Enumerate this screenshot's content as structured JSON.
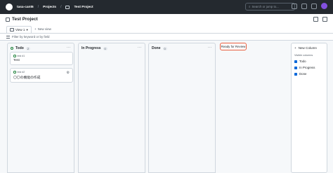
{
  "topbar": {
    "owner": "tasa-cant6",
    "projects": "Projects",
    "project": "Test Project",
    "search_placeholder": "Search or jump to..."
  },
  "header": {
    "title": "Test Project"
  },
  "views": {
    "active_tab": "View 1",
    "new_view": "New view",
    "filter_placeholder": "Filter by keyword or by field"
  },
  "columns": [
    {
      "name": "Todo",
      "count": "2",
      "color": "#1a7f37",
      "cards": [
        {
          "meta": "test #1",
          "title": "Test"
        },
        {
          "meta": "test #2",
          "title": "〇〇の機能の作成"
        }
      ]
    },
    {
      "name": "In Progress",
      "count": "0",
      "color": "#bf8700",
      "cards": []
    },
    {
      "name": "Done",
      "count": "0",
      "color": "#8250df",
      "cards": []
    }
  ],
  "add_column": {
    "input_value": "Ready for Review"
  },
  "new_column_panel": {
    "title": "New Column",
    "subtitle": "Visible columns",
    "items": [
      "Todo",
      "In Progress",
      "Done"
    ]
  }
}
